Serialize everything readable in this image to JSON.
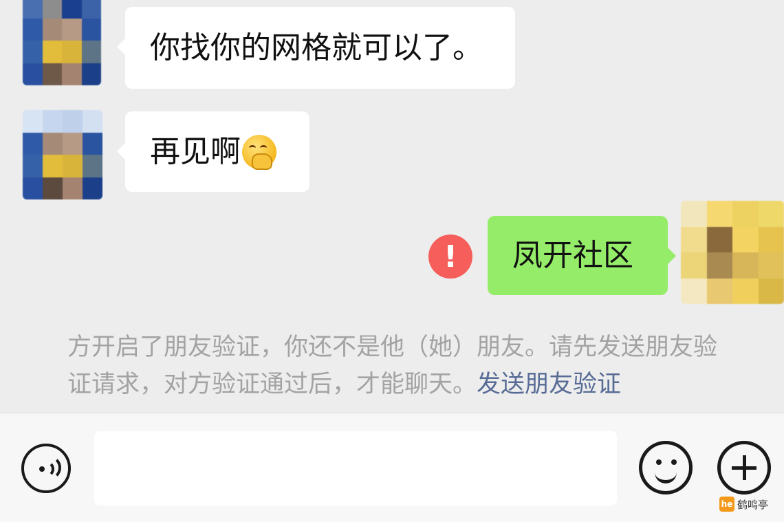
{
  "colors": {
    "chat_background": "#ededed",
    "incoming_bubble": "#ffffff",
    "outgoing_bubble": "#95ec69",
    "error_badge": "#f55e5a",
    "system_text": "#a3a3a3",
    "link": "#576b95",
    "bottom_bar": "#f7f7f7"
  },
  "messages": [
    {
      "direction": "incoming",
      "text": "你找你的网格就可以了。",
      "avatar": "blurred-avatar"
    },
    {
      "direction": "incoming",
      "text": "再见啊",
      "emoji": "hand-over-mouth-face-emoji",
      "avatar": "blurred-avatar"
    },
    {
      "direction": "outgoing",
      "text": "凤开社区",
      "status": "send-failed",
      "status_glyph": "!",
      "avatar": "blurred-avatar"
    }
  ],
  "system_notice": {
    "text": "方开启了朋友验证，你还不是他（她）朋友。请先发送朋友验证请求，对方验证通过后，才能聊天。",
    "link": "发送朋友验证"
  },
  "input_bar": {
    "voice_icon": "voice-icon",
    "input_value": "",
    "emoji_icon": "emoji-icon",
    "plus_icon": "plus-icon"
  },
  "watermark": {
    "logo_text": "he",
    "text": "鹤鸣亭"
  }
}
